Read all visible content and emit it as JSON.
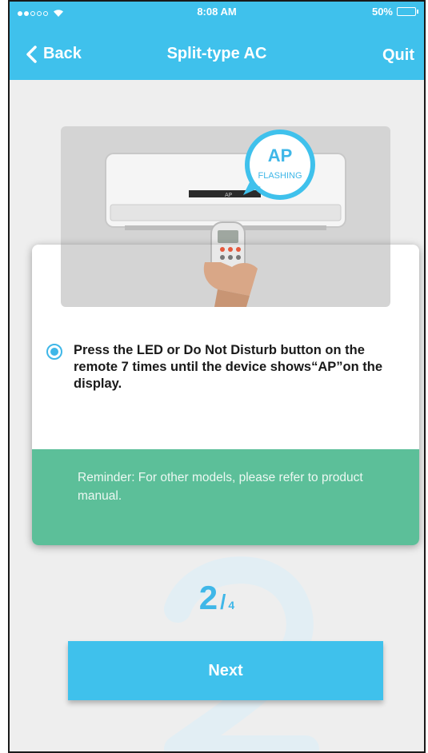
{
  "status_bar": {
    "time": "8:08 AM",
    "battery": "50%",
    "battery_level": 0.5,
    "signal_icon": "signal-dots-icon",
    "wifi_icon": "wifi-icon"
  },
  "nav": {
    "back_label": "Back",
    "title": "Split-type AC",
    "quit_label": "Quit"
  },
  "illustration": {
    "badge_main": "AP",
    "badge_sub": "FLASHING",
    "ac_display": "AP"
  },
  "instruction": {
    "text": "Press the LED or Do Not Disturb button on the remote 7 times until the device shows“AP”on the display.",
    "selected": true
  },
  "reminder": {
    "text": "Reminder: For other models, please refer to product manual."
  },
  "step": {
    "current": "2",
    "separator": "/",
    "total": "4"
  },
  "next_button": {
    "label": "Next"
  },
  "colors": {
    "primary": "#3fc1ec",
    "reminder_bg": "#5cbf99",
    "background": "#eeeeee"
  }
}
